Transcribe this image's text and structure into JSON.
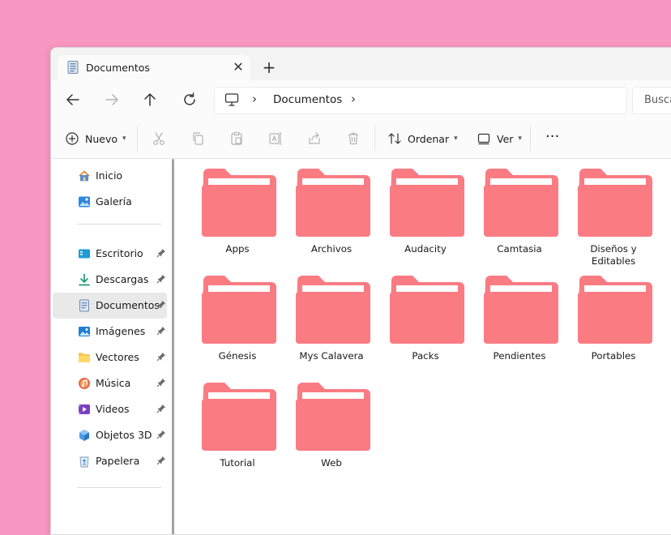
{
  "tab": {
    "title": "Documentos",
    "close": "✕",
    "new": "+"
  },
  "address": {
    "path": "Documentos",
    "sep": "›"
  },
  "search": {
    "placeholder": "Buscar en Documentos",
    "visible": "Busca"
  },
  "toolbar": {
    "new_label": "Nuevo",
    "sort_label": "Ordenar",
    "view_label": "Ver",
    "more": "···"
  },
  "sidebar": {
    "items": [
      {
        "label": "Inicio",
        "icon": "home-icon"
      },
      {
        "label": "Galería",
        "icon": "gallery-icon"
      },
      {
        "label": "Escritorio",
        "icon": "desktop-icon",
        "pinned": true
      },
      {
        "label": "Descargas",
        "icon": "download-icon",
        "pinned": true
      },
      {
        "label": "Documentos",
        "icon": "document-icon",
        "pinned": true,
        "selected": true
      },
      {
        "label": "Imágenes",
        "icon": "pictures-icon",
        "pinned": true
      },
      {
        "label": "Vectores",
        "icon": "folder-icon",
        "pinned": true
      },
      {
        "label": "Música",
        "icon": "music-icon",
        "pinned": true
      },
      {
        "label": "Videos",
        "icon": "videos-icon",
        "pinned": true
      },
      {
        "label": "Objetos 3D",
        "icon": "objects-3d-icon",
        "pinned": true
      },
      {
        "label": "Papelera",
        "icon": "recycle-bin-icon",
        "pinned": true
      }
    ]
  },
  "folders": [
    {
      "line1": "Apps",
      "line2": ""
    },
    {
      "line1": "Archivos",
      "line2": ""
    },
    {
      "line1": "Audacity",
      "line2": ""
    },
    {
      "line1": "Camtasia",
      "line2": ""
    },
    {
      "line1": "Diseños y",
      "line2": "Editables"
    },
    {
      "line1": "Génesis",
      "line2": ""
    },
    {
      "line1": "Mys Calavera",
      "line2": ""
    },
    {
      "line1": "Packs",
      "line2": ""
    },
    {
      "line1": "Pendientes",
      "line2": ""
    },
    {
      "line1": "Portables",
      "line2": ""
    },
    {
      "line1": "Tutorial",
      "line2": ""
    },
    {
      "line1": "Web",
      "line2": ""
    }
  ],
  "colors": {
    "desktop_bg": "#f897c1",
    "folder": "#fb7b83",
    "folder_paper": "#ffffff"
  }
}
